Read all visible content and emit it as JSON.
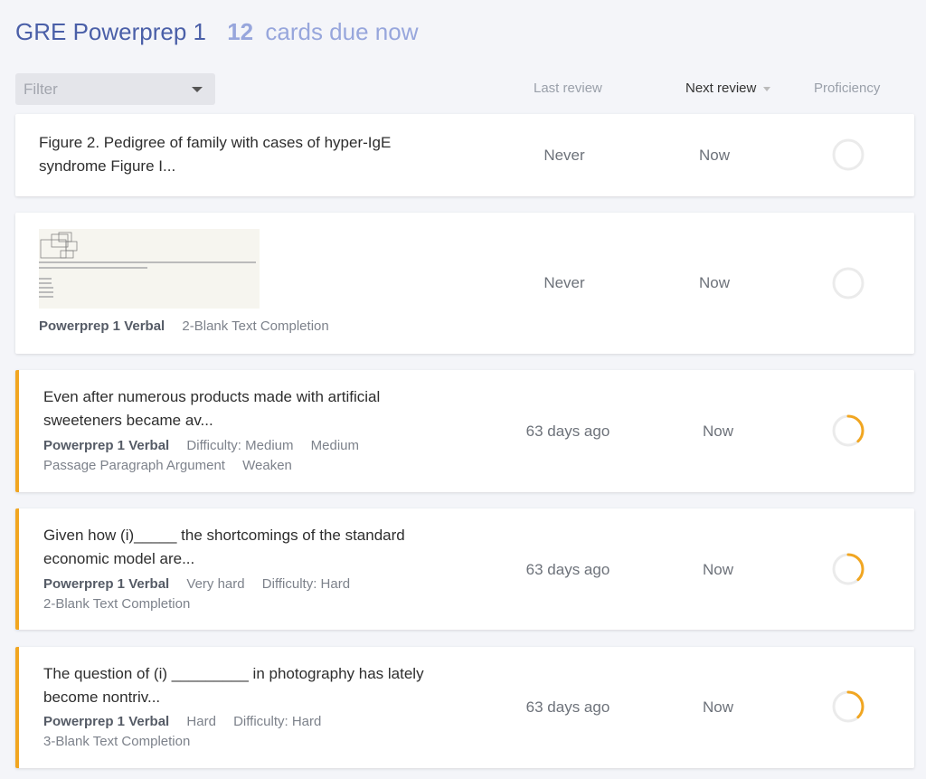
{
  "header": {
    "deck_title": "GRE Powerprep 1",
    "due_count": "12",
    "due_text": "cards due now"
  },
  "filter": {
    "placeholder": "Filter"
  },
  "columns": {
    "last_review": "Last review",
    "next_review": "Next review",
    "proficiency": "Proficiency"
  },
  "colors": {
    "accent": "#f1a621",
    "title": "#4a5fa8",
    "due": "#97a6dc",
    "ring_track": "#ebebeb"
  },
  "cards": [
    {
      "text": "Figure 2. Pedigree of family with cases of hyper-IgE syndrome Figure I...",
      "tags": [],
      "last_review": "Never",
      "next_review": "Now",
      "proficiency": 0,
      "accent": false
    },
    {
      "text": "",
      "has_image": true,
      "tags": [
        "Powerprep 1 Verbal",
        "2-Blank Text Completion"
      ],
      "last_review": "Never",
      "next_review": "Now",
      "proficiency": 0,
      "accent": false
    },
    {
      "text": "Even after numerous products made with artificial sweeteners became av...",
      "tags": [
        "Powerprep 1 Verbal",
        "Difficulty: Medium",
        "Medium",
        "Passage Paragraph Argument",
        "Weaken"
      ],
      "last_review": "63 days ago",
      "next_review": "Now",
      "proficiency": 0.38,
      "accent": true
    },
    {
      "text": "Given how (i)_____ the shortcomings of the standard economic model are...",
      "tags": [
        "Powerprep 1 Verbal",
        "Very hard",
        "Difficulty: Hard",
        "2-Blank Text Completion"
      ],
      "last_review": "63 days ago",
      "next_review": "Now",
      "proficiency": 0.38,
      "accent": true
    },
    {
      "text": "The question of (i) _________ in photography has lately become nontriv...",
      "tags": [
        "Powerprep 1 Verbal",
        "Hard",
        "Difficulty: Hard",
        "3-Blank Text Completion"
      ],
      "last_review": "63 days ago",
      "next_review": "Now",
      "proficiency": 0.38,
      "accent": true
    }
  ]
}
